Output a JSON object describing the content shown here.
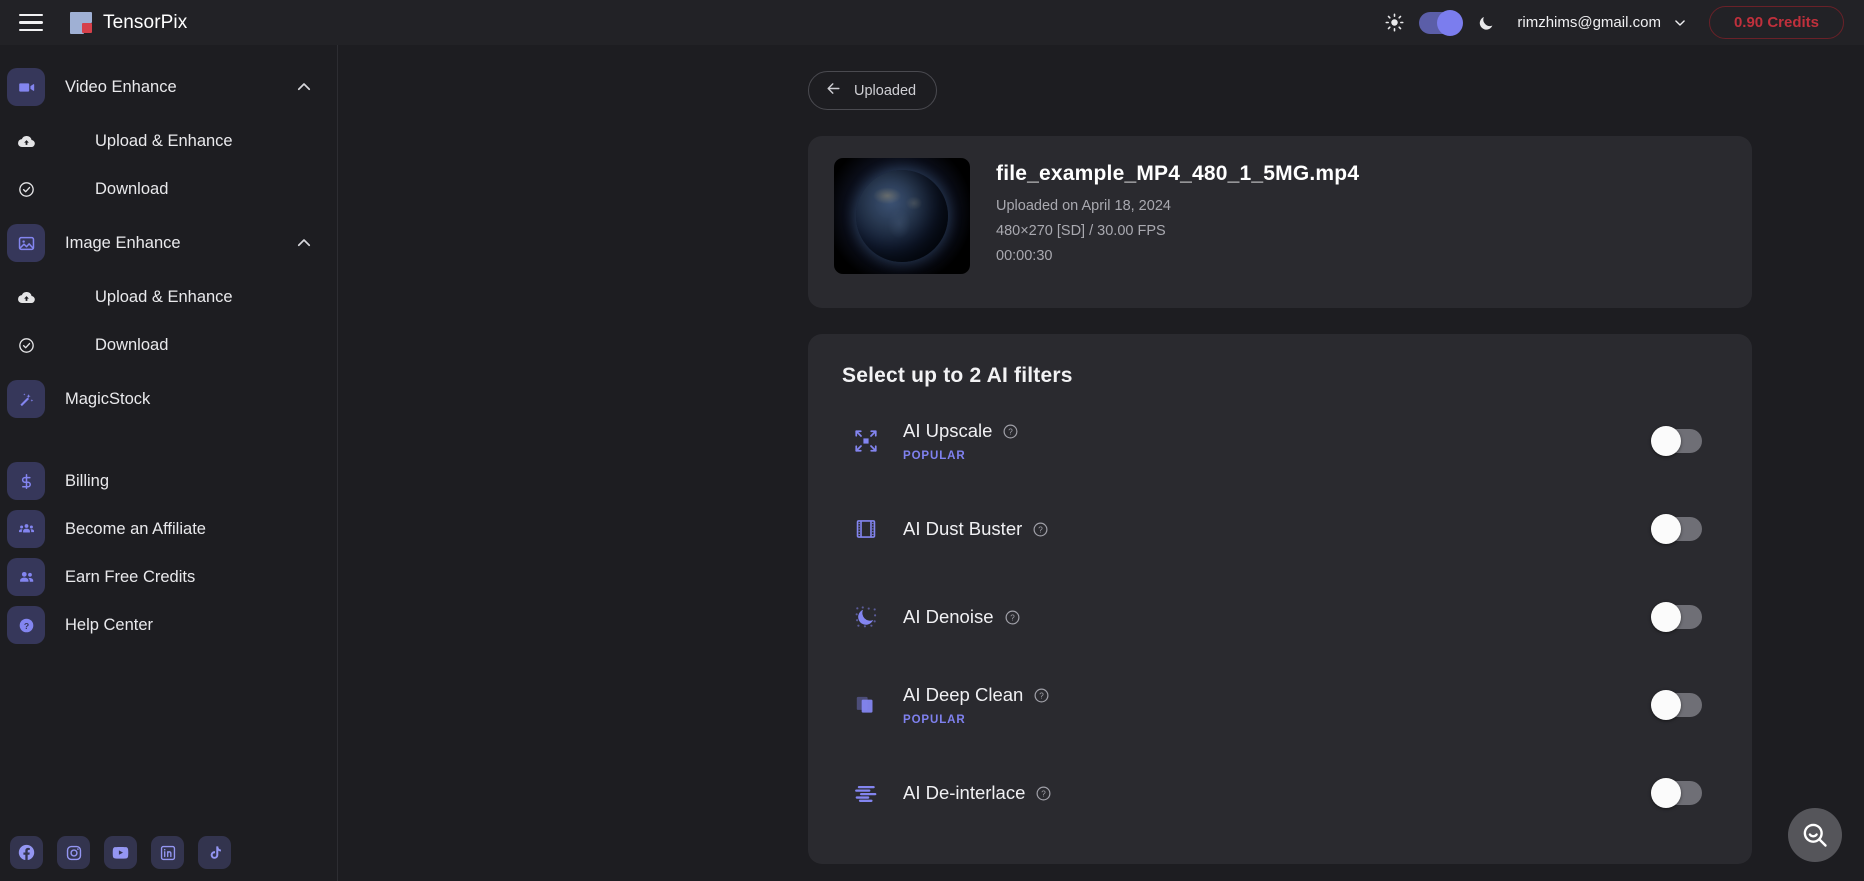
{
  "topbar": {
    "menu_icon": "hamburger-menu-icon",
    "brand_name": "TensorPix",
    "sun_icon": "sun-icon",
    "moon_icon": "moon-icon",
    "theme_toggle_state": "dark",
    "account_email": "rimzhims@gmail.com",
    "account_chevron_icon": "chevron-down-icon",
    "credits_label": "0.90 Credits",
    "credits_color": "#c0303c"
  },
  "sidebar": {
    "groups": [
      {
        "label": "Video Enhance",
        "icon": "video-camera-icon",
        "caret": "chevron-up-icon",
        "children": [
          {
            "label": "Upload & Enhance",
            "icon": "cloud-upload-icon"
          },
          {
            "label": "Download",
            "icon": "check-circle-icon"
          }
        ]
      },
      {
        "label": "Image Enhance",
        "icon": "image-icon",
        "caret": "chevron-up-icon",
        "children": [
          {
            "label": "Upload & Enhance",
            "icon": "cloud-upload-icon"
          },
          {
            "label": "Download",
            "icon": "check-circle-icon"
          }
        ]
      }
    ],
    "items": [
      {
        "label": "MagicStock",
        "icon": "magic-wand-icon"
      },
      {
        "label": "Billing",
        "icon": "dollar-icon"
      },
      {
        "label": "Become an Affiliate",
        "icon": "people-group-icon"
      },
      {
        "label": "Earn Free Credits",
        "icon": "two-people-icon"
      },
      {
        "label": "Help Center",
        "icon": "question-circle-icon"
      }
    ],
    "socials": [
      {
        "name": "facebook-icon"
      },
      {
        "name": "instagram-icon"
      },
      {
        "name": "youtube-icon"
      },
      {
        "name": "linkedin-icon"
      },
      {
        "name": "tiktok-icon"
      }
    ]
  },
  "main": {
    "back_button": {
      "label": "Uploaded",
      "icon": "arrow-left-icon"
    },
    "file": {
      "thumbnail": "earth-at-night-video-thumbnail",
      "name": "file_example_MP4_480_1_5MG.mp4",
      "uploaded_on": "Uploaded on April 18, 2024",
      "resolution": "480×270 [SD] / 30.00 FPS",
      "duration": "00:00:30"
    },
    "filters_title": "Select up to 2 AI filters",
    "filters": [
      {
        "name": "AI Upscale",
        "icon": "upscale-arrows-icon",
        "badge": "POPULAR",
        "enabled": false
      },
      {
        "name": "AI Dust Buster",
        "icon": "film-strip-icon",
        "badge": "",
        "enabled": false
      },
      {
        "name": "AI Denoise",
        "icon": "moon-noise-icon",
        "badge": "",
        "enabled": false
      },
      {
        "name": "AI Deep Clean",
        "icon": "deep-clean-icon",
        "badge": "POPULAR",
        "enabled": false
      },
      {
        "name": "AI De-interlace",
        "icon": "interlace-lines-icon",
        "badge": "",
        "enabled": false
      }
    ],
    "help_icon": "question-mark-circle-icon",
    "fab": {
      "icon": "search-smile-icon"
    }
  }
}
